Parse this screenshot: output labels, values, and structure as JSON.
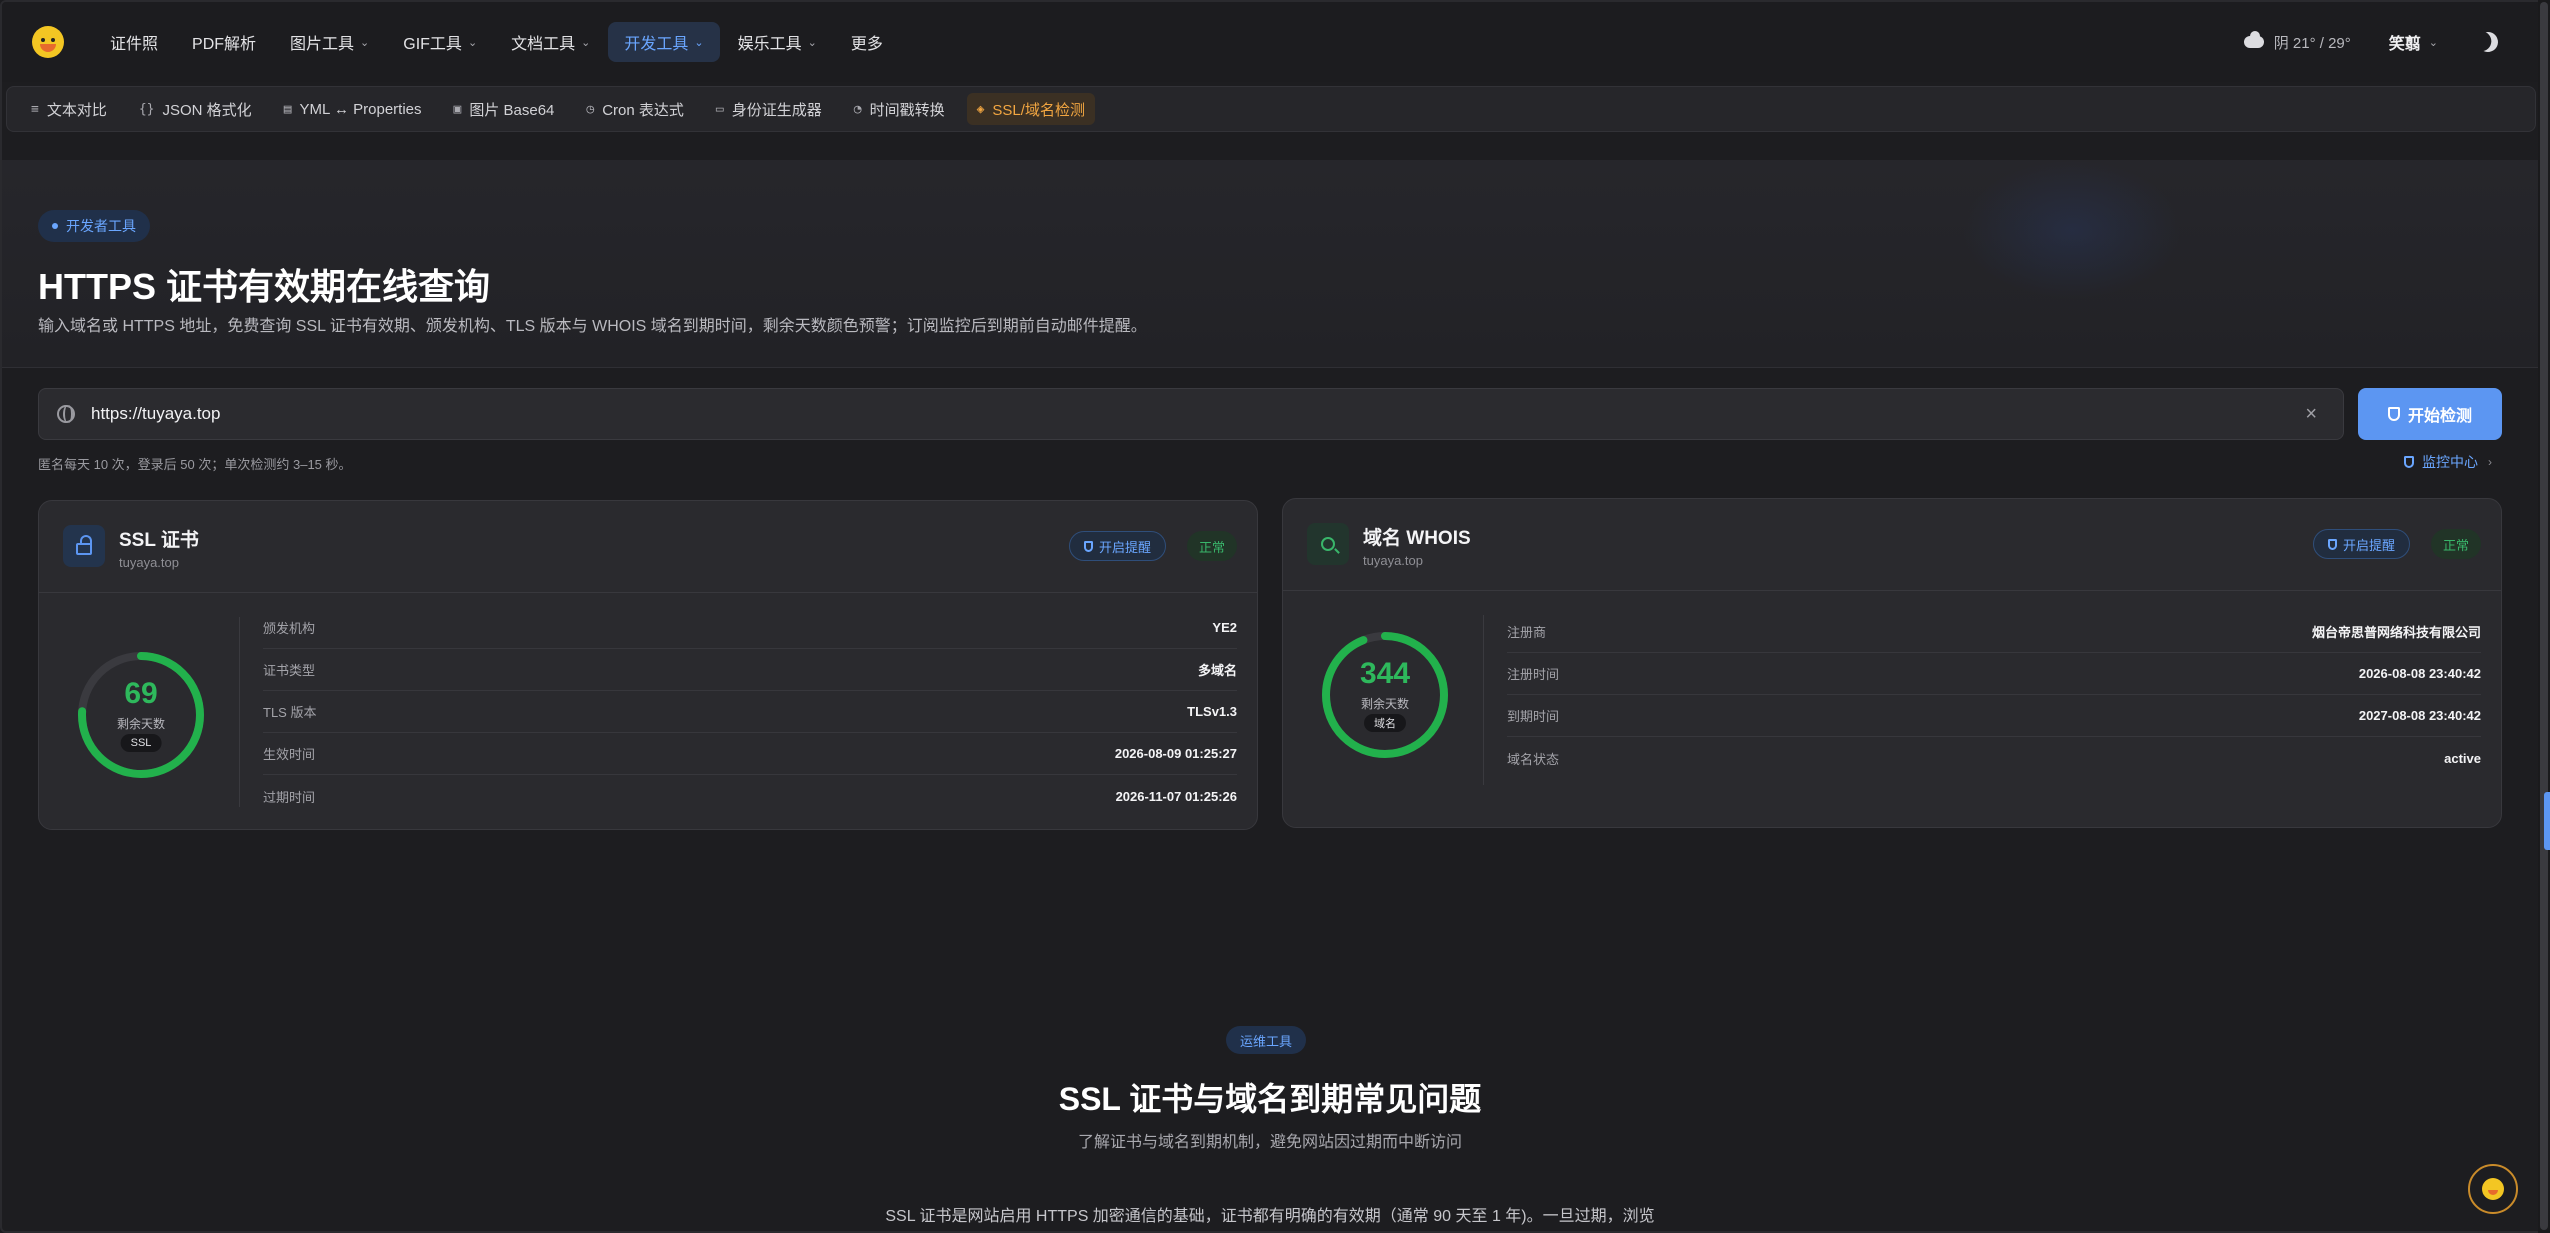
{
  "nav": {
    "items": [
      {
        "label": "证件照",
        "dropdown": false
      },
      {
        "label": "PDF解析",
        "dropdown": false
      },
      {
        "label": "图片工具",
        "dropdown": true
      },
      {
        "label": "GIF工具",
        "dropdown": true
      },
      {
        "label": "文档工具",
        "dropdown": true
      },
      {
        "label": "开发工具",
        "dropdown": true,
        "active": true
      },
      {
        "label": "娱乐工具",
        "dropdown": true
      },
      {
        "label": "更多",
        "dropdown": false
      }
    ],
    "weather": "阴 21° / 29°",
    "user": "笑翦"
  },
  "subnav": [
    {
      "icon": "≡",
      "label": "文本对比"
    },
    {
      "icon": "{}",
      "label": "JSON 格式化"
    },
    {
      "icon": "▤",
      "label": "YML ↔ Properties"
    },
    {
      "icon": "▣",
      "label": "图片 Base64"
    },
    {
      "icon": "◷",
      "label": "Cron 表达式"
    },
    {
      "icon": "▭",
      "label": "身份证生成器"
    },
    {
      "icon": "◔",
      "label": "时间戳转换"
    },
    {
      "icon": "◈",
      "label": "SSL/域名检测",
      "active": true
    }
  ],
  "hero": {
    "badge": "开发者工具",
    "title": "HTTPS 证书有效期在线查询",
    "desc": "输入域名或 HTTPS 地址，免费查询 SSL 证书有效期、颁发机构、TLS 版本与 WHOIS 域名到期时间，剩余天数颜色预警；订阅监控后到期前自动邮件提醒。"
  },
  "search": {
    "value": "https://tuyaya.top",
    "button": "开始检测",
    "hint": "匿名每天 10 次，登录后 50 次；单次检测约 3–15 秒。",
    "monitor": "监控中心"
  },
  "ssl_card": {
    "title": "SSL 证书",
    "domain": "tuyaya.top",
    "remind": "开启提醒",
    "status": "正常",
    "days": "69",
    "days_label": "剩余天数",
    "tag": "SSL",
    "progress": 0.76,
    "rows": [
      {
        "k": "颁发机构",
        "v": "YE2"
      },
      {
        "k": "证书类型",
        "v": "多域名"
      },
      {
        "k": "TLS 版本",
        "v": "TLSv1.3"
      },
      {
        "k": "生效时间",
        "v": "2026-08-09 01:25:27"
      },
      {
        "k": "过期时间",
        "v": "2026-11-07 01:25:26"
      }
    ]
  },
  "whois_card": {
    "title": "域名 WHOIS",
    "domain": "tuyaya.top",
    "remind": "开启提醒",
    "status": "正常",
    "days": "344",
    "days_label": "剩余天数",
    "tag": "域名",
    "progress": 0.94,
    "rows": [
      {
        "k": "注册商",
        "v": "烟台帝思普网络科技有限公司"
      },
      {
        "k": "注册时间",
        "v": "2026-08-08 23:40:42"
      },
      {
        "k": "到期时间",
        "v": "2027-08-08 23:40:42"
      },
      {
        "k": "域名状态",
        "v": "active"
      }
    ]
  },
  "faq": {
    "badge": "运维工具",
    "title": "SSL 证书与域名到期常见问题",
    "subtitle": "了解证书与域名到期机制，避免网站因过期而中断访问",
    "para": "SSL 证书是网站启用 HTTPS 加密通信的基础，证书都有明确的有效期（通常 90 天至 1 年)。一旦过期，浏览"
  },
  "colors": {
    "accent": "#5c96f2",
    "ok": "#2eb85c",
    "active_sub": "#f2a641"
  }
}
